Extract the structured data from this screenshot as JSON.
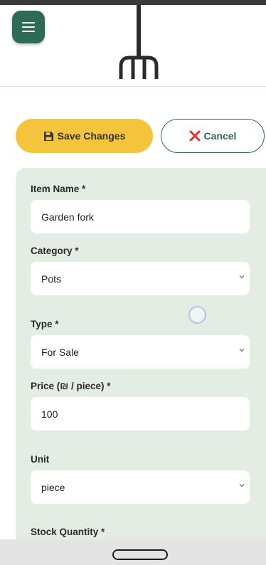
{
  "header": {
    "menu_icon": "hamburger-menu-icon",
    "logo_icon": "garden-fork-icon"
  },
  "colors": {
    "primary_green": "#2e6b55",
    "accent_yellow": "#f4c43c",
    "form_bg": "#e3ede4",
    "cancel_red": "#e0312b"
  },
  "actions": {
    "save_label": "Save Changes",
    "save_icon": "floppy-disk-icon",
    "cancel_label": "Cancel",
    "cancel_icon": "x-close-icon"
  },
  "form": {
    "item_name": {
      "label": "Item Name *",
      "value": "Garden fork"
    },
    "category": {
      "label": "Category *",
      "value": "Pots"
    },
    "type": {
      "label": "Type *",
      "value": "For Sale"
    },
    "price": {
      "label": "Price (₪ / piece) *",
      "value": "100"
    },
    "unit": {
      "label": "Unit",
      "value": "piece"
    },
    "stock": {
      "label": "Stock Quantity *"
    }
  }
}
